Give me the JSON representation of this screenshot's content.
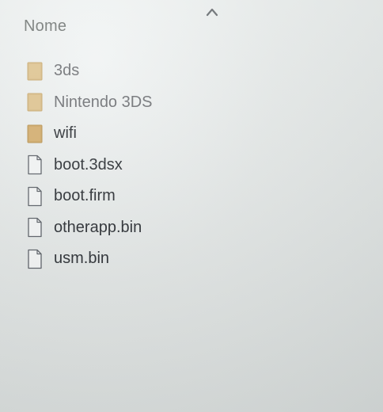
{
  "header": {
    "column_name": "Nome",
    "sort_indicator": "sort-ascending-icon"
  },
  "files": [
    {
      "name": "3ds",
      "type": "folder",
      "icon": "folder-icon"
    },
    {
      "name": "Nintendo 3DS",
      "type": "folder",
      "icon": "folder-icon"
    },
    {
      "name": "wifi",
      "type": "folder",
      "icon": "folder-icon"
    },
    {
      "name": "boot.3dsx",
      "type": "file",
      "icon": "file-icon"
    },
    {
      "name": "boot.firm",
      "type": "file",
      "icon": "file-icon"
    },
    {
      "name": "otherapp.bin",
      "type": "file",
      "icon": "file-icon"
    },
    {
      "name": "usm.bin",
      "type": "file",
      "icon": "file-icon"
    }
  ],
  "colors": {
    "folder": "#d8b77a",
    "folder_dark": "#c9a462",
    "file_outline": "#5a5f66",
    "text": "#2a2e33"
  }
}
